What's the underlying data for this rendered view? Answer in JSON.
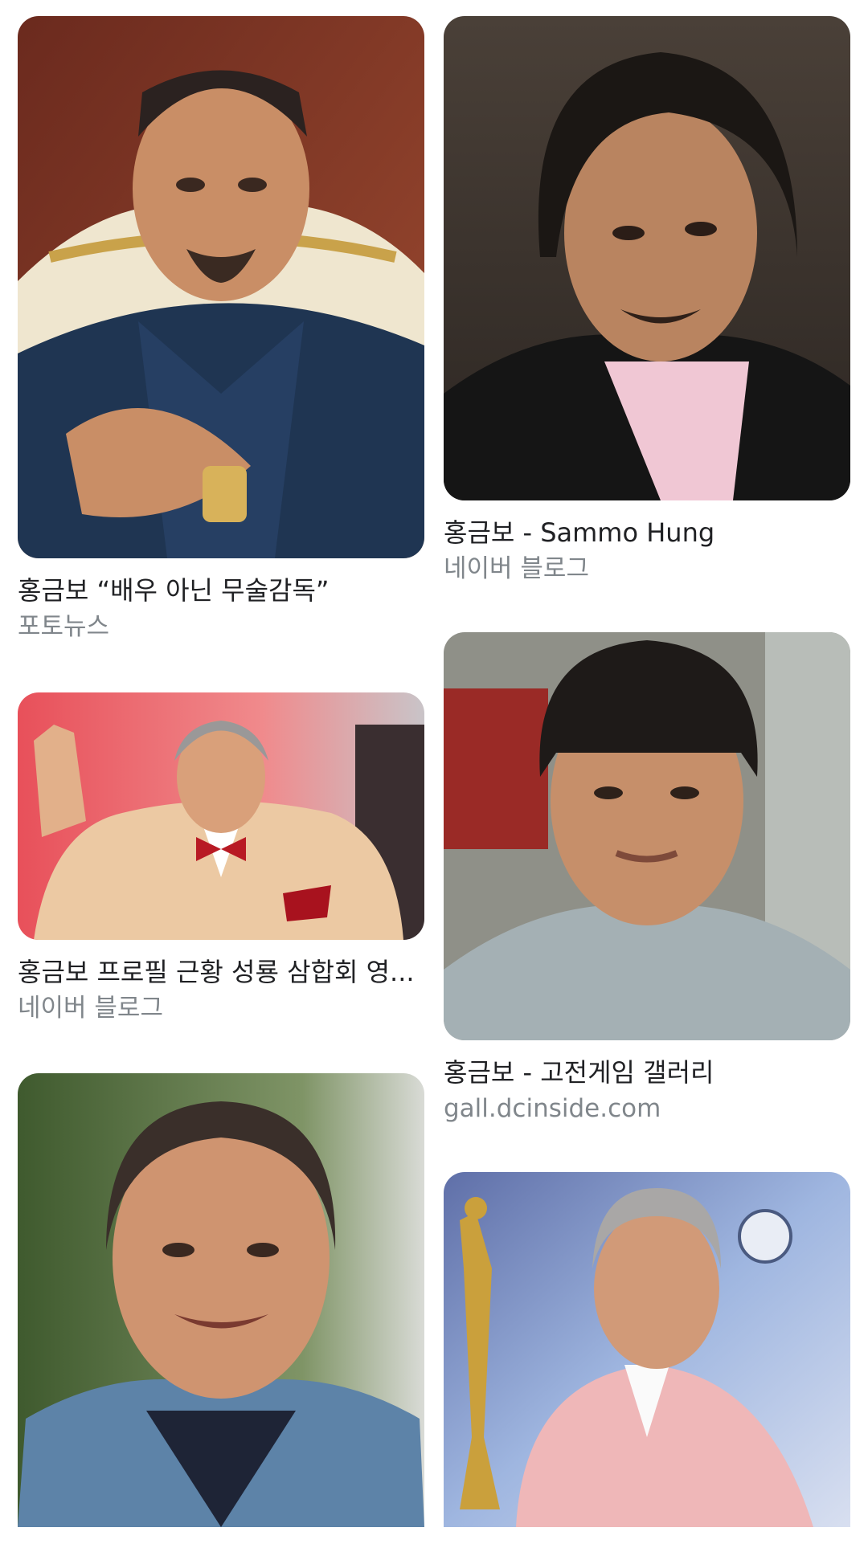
{
  "results": [
    {
      "title": "홍금보 “배우 아닌 무술감독”",
      "source": "포토뉴스",
      "image_alt": "man seated in ornate chair wearing denim shirt, hands clasped, wristwatch"
    },
    {
      "title": "홍금보 - Sammo Hung",
      "source": "네이버 블로그",
      "image_alt": "man with long dark hair in black leather jacket looking sideways"
    },
    {
      "title": "홍금보 프로필 근황 성룡 삼합회 영...",
      "source": "네이버 블로그",
      "image_alt": "grey-haired man in cream suit with red bow tie waving"
    },
    {
      "title": "홍금보 - 고전게임 갤러리",
      "source": "gall.dcinside.com",
      "image_alt": "young man with bowl haircut in grey shirt"
    },
    {
      "title": "",
      "source": "",
      "image_alt": "smiling man with slicked hair in denim jacket outdoors"
    },
    {
      "title": "",
      "source": "",
      "image_alt": "grey-haired man in pink suit holding golden trophy"
    }
  ],
  "colors": {
    "title_text": "#202124",
    "source_text": "#80868b",
    "background": "#ffffff"
  }
}
